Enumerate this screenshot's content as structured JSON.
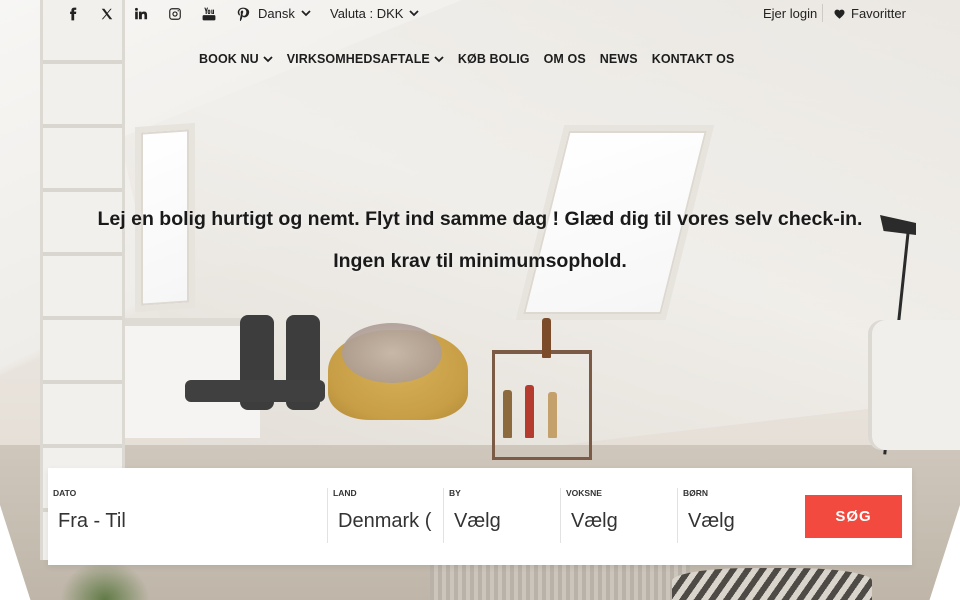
{
  "topbar": {
    "social_icons": [
      "facebook-icon",
      "x-twitter-icon",
      "linkedin-icon",
      "instagram-icon",
      "youtube-icon",
      "pinterest-icon"
    ],
    "language": "Dansk",
    "currency": "Valuta : DKK",
    "owner_login": "Ejer login",
    "favorites": "Favoritter"
  },
  "nav": {
    "items": [
      {
        "label": "BOOK NU",
        "has_dropdown": true
      },
      {
        "label": "VIRKSOMHEDSAFTALE",
        "has_dropdown": true
      },
      {
        "label": "KØB BOLIG",
        "has_dropdown": false
      },
      {
        "label": "OM OS",
        "has_dropdown": false
      },
      {
        "label": "NEWS",
        "has_dropdown": false
      },
      {
        "label": "KONTAKT OS",
        "has_dropdown": false
      }
    ]
  },
  "hero": {
    "headline": "Lej en bolig hurtigt og nemt. Flyt ind samme dag ! Glæd dig til vores selv check-in.",
    "subline": "Ingen krav til minimumsophold."
  },
  "search": {
    "date_label": "DATO",
    "date_value": "Fra - Til",
    "country_label": "LAND",
    "country_value": "Denmark (",
    "city_label": "BY",
    "city_value": "Vælg",
    "adults_label": "VOKSNE",
    "adults_value": "Vælg",
    "children_label": "BØRN",
    "children_value": "Vælg",
    "button": "SØG"
  },
  "colors": {
    "accent": "#f24a3f",
    "text": "#1d1d1d"
  }
}
